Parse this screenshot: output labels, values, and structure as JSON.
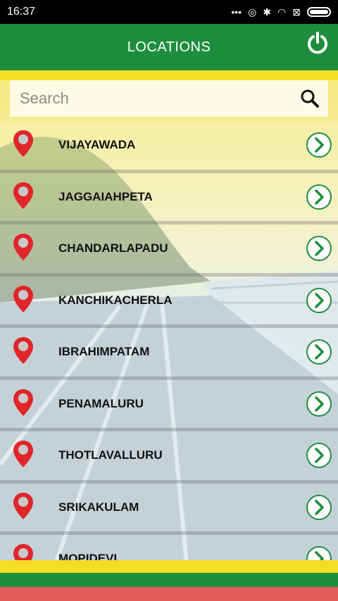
{
  "status_bar": {
    "time": "16:37",
    "icons": [
      "more-icon",
      "sync-icon",
      "bluetooth-icon",
      "wifi-icon",
      "sim-icon",
      "battery-icon"
    ]
  },
  "header": {
    "title": "LOCATIONS",
    "power_icon": "power-icon"
  },
  "search": {
    "placeholder": "Search"
  },
  "locations": [
    {
      "name": "VIJAYAWADA"
    },
    {
      "name": "JAGGAIAHPETA"
    },
    {
      "name": "CHANDARLAPADU"
    },
    {
      "name": "KANCHIKACHERLA"
    },
    {
      "name": "IBRAHIMPATAM"
    },
    {
      "name": "PENAMALURU"
    },
    {
      "name": "THOTLAVALLURU"
    },
    {
      "name": "SRIKAKULAM"
    },
    {
      "name": "MOPIDEVI"
    }
  ],
  "colors": {
    "header_green": "#1e8e3e",
    "pin_red": "#e0262b",
    "band_yellow": "#f4dd22",
    "accent_green": "#1e8e3e"
  }
}
